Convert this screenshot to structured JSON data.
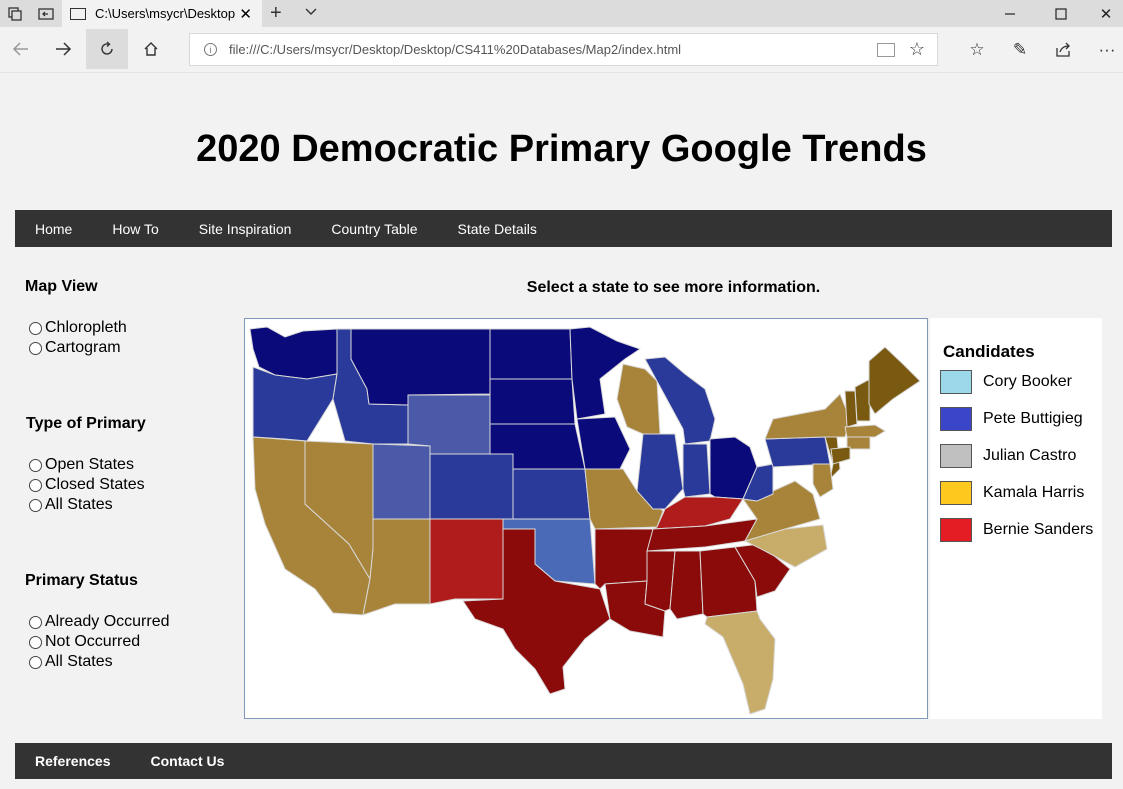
{
  "browser": {
    "tab_title": "C:\\Users\\msycr\\Desktop",
    "url": "file:///C:/Users/msycr/Desktop/Desktop/CS411%20Databases/Map2/index.html"
  },
  "page": {
    "title": "2020 Democratic Primary Google Trends",
    "instruction": "Select a state to see more information."
  },
  "nav": {
    "items": [
      {
        "label": "Home"
      },
      {
        "label": "How To"
      },
      {
        "label": "Site Inspiration"
      },
      {
        "label": "Country Table"
      },
      {
        "label": "State Details"
      }
    ]
  },
  "sidebar": {
    "map_view": {
      "heading": "Map View",
      "options": [
        {
          "label": "Chloropleth"
        },
        {
          "label": "Cartogram"
        }
      ]
    },
    "primary_type": {
      "heading": "Type of Primary",
      "options": [
        {
          "label": "Open States"
        },
        {
          "label": "Closed States"
        },
        {
          "label": "All States"
        }
      ]
    },
    "primary_status": {
      "heading": "Primary Status",
      "options": [
        {
          "label": "Already Occurred"
        },
        {
          "label": "Not Occurred"
        },
        {
          "label": "All States"
        }
      ]
    }
  },
  "legend": {
    "heading": "Candidates",
    "items": [
      {
        "label": "Cory Booker",
        "color": "#9ad8ea"
      },
      {
        "label": "Pete Buttigieg",
        "color": "#3a45c8"
      },
      {
        "label": "Julian Castro",
        "color": "#c0c0c0"
      },
      {
        "label": "Kamala Harris",
        "color": "#ffc81e"
      },
      {
        "label": "Bernie Sanders",
        "color": "#e41c24"
      }
    ]
  },
  "map_colors": {
    "navy": "#0a0a7a",
    "blue": "#2a3a9a",
    "slate": "#4a5aa8",
    "steel": "#4a6ab8",
    "gold": "#a8843a",
    "tan": "#c8ad6a",
    "brown": "#7a5a10",
    "red": "#8b0a0a",
    "brick": "#b01c1c"
  },
  "footer": {
    "items": [
      {
        "label": "References"
      },
      {
        "label": "Contact Us"
      }
    ]
  }
}
